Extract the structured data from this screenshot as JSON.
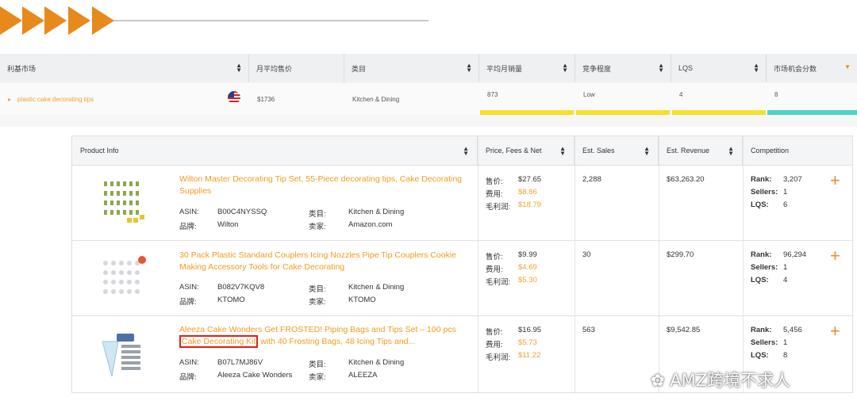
{
  "market_table": {
    "headers": [
      "利基市场",
      "月平均售价",
      "类目",
      "平均月销量",
      "竞争程度",
      "LQS",
      "市场机会分数"
    ],
    "row": {
      "keyword": "plastic cake decorating tips",
      "price": "$1736",
      "category": "Kitchen & Dining",
      "monthly_sales": "873",
      "competition": "Low",
      "lqs": "4",
      "opportunity": "8"
    },
    "colors": {
      "accent": "#e8891c",
      "bar_yellow": "#f6df2c",
      "bar_teal": "#4fd3c4"
    }
  },
  "product_table": {
    "headers": {
      "product_info": "Product Info",
      "price": "Price, Fees & Net",
      "sales": "Est. Sales",
      "revenue": "Est. Revenue",
      "competition": "Competition"
    },
    "labels": {
      "asin": "ASIN:",
      "brand": "品牌:",
      "category": "类目:",
      "seller": "卖家:",
      "price": "售价:",
      "fees": "费用:",
      "net": "毛利润:",
      "rank": "Rank:",
      "sellers": "Sellers:",
      "lqs": "LQS:"
    },
    "rows": [
      {
        "title": "Wilton Master Decorating Tip Set, 55-Piece decorating tips, Cake Decorating Supplies",
        "asin": "B00C4NYSSQ",
        "brand": "Wilton",
        "category": "Kitchen & Dining",
        "seller": "Amazon.com",
        "price": "$27.65",
        "fees": "$8.86",
        "net": "$18.79",
        "sales": "2,288",
        "revenue": "$63,263.20",
        "rank": "3,207",
        "sellers": "1",
        "lqs": "6"
      },
      {
        "title": "30 Pack Plastic Standard Couplers Icing Nozzles Pipe Tip Couplers Cookie Making Accessory Tools for Cake Decorating",
        "asin": "B082V7KQV8",
        "brand": "KTOMO",
        "category": "Kitchen & Dining",
        "seller": "KTOMO",
        "price": "$9.99",
        "fees": "$4.69",
        "net": "$5.30",
        "sales": "30",
        "revenue": "$299.70",
        "rank": "96,294",
        "sellers": "1",
        "lqs": "4"
      },
      {
        "title_pre": "Aleeza Cake Wonders Get FROSTED! Piping Bags and Tips Set – 100 pcs ",
        "title_hl": "Cake Decorating Kit",
        "title_post": " with 40 Frosting Bags, 48 Icing Tips and...",
        "asin": "B07L7MJ86V",
        "brand": "Aleeza Cake Wonders",
        "category": "Kitchen & Dining",
        "seller": "ALEEZA",
        "price": "$16.95",
        "fees": "$5.73",
        "net": "$11.22",
        "sales": "563",
        "revenue": "$9,542.85",
        "rank": "5,456",
        "sellers": "1",
        "lqs": "8"
      }
    ]
  },
  "watermark": "AMZ跨境不求人"
}
